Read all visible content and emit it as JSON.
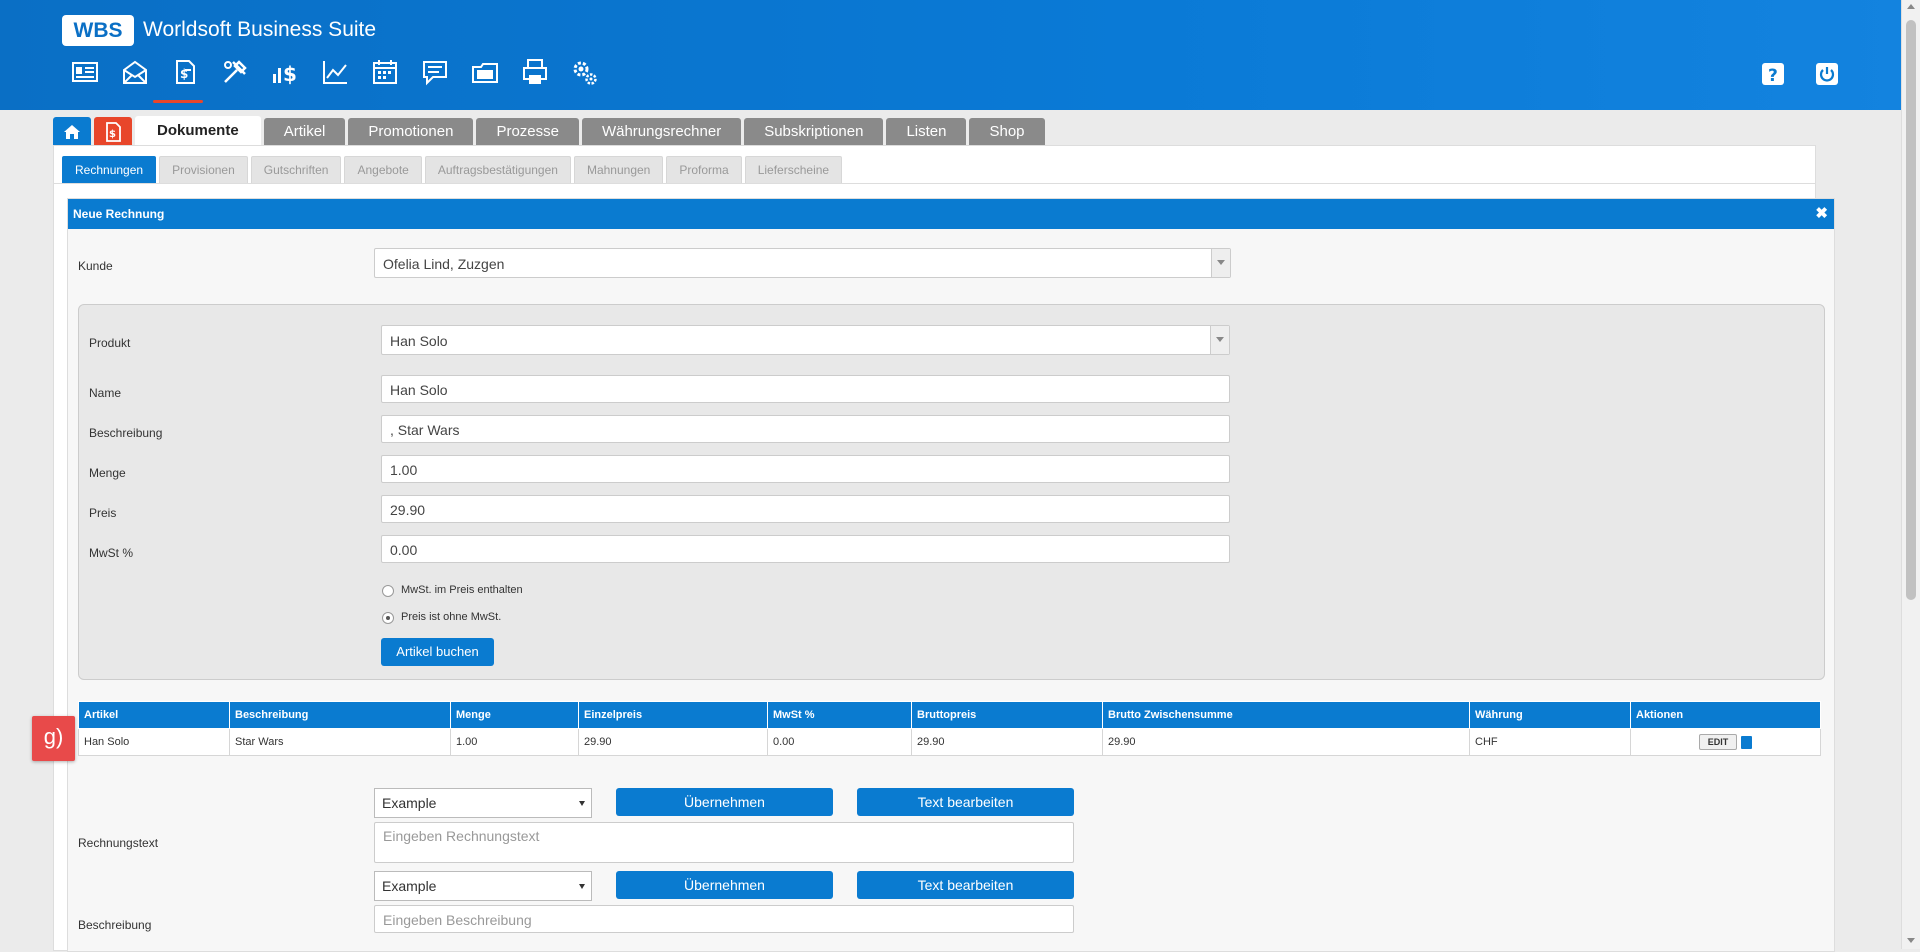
{
  "header": {
    "logo": "WBS",
    "app_title": "Worldsoft Business Suite",
    "nav_icons": [
      "contacts-icon",
      "mail-icon",
      "documents-icon",
      "tools-icon",
      "finance-icon",
      "chart-icon",
      "calendar-icon",
      "messages-icon",
      "files-icon",
      "print-icon",
      "settings-icon"
    ],
    "help_icon": "help-icon",
    "power_icon": "power-icon",
    "accent": "#e8462a",
    "brand": "#0a7bd0"
  },
  "main_tabs": {
    "home_icon": "home-icon",
    "docs_icon": "documents-tab-icon",
    "items": [
      "Dokumente",
      "Artikel",
      "Promotionen",
      "Prozesse",
      "Währungsrechner",
      "Subskriptionen",
      "Listen",
      "Shop"
    ]
  },
  "sub_tabs": [
    "Rechnungen",
    "Provisionen",
    "Gutschriften",
    "Angebote",
    "Auftragsbestätigungen",
    "Mahnungen",
    "Proforma",
    "Lieferscheine"
  ],
  "form": {
    "title": "Neue Rechnung",
    "close": "✖",
    "kunde_label": "Kunde",
    "kunde_value": "Ofelia Lind, Zuzgen",
    "produkt_label": "Produkt",
    "produkt_value": "Han Solo",
    "name_label": "Name",
    "name_value": "Han Solo",
    "beschreibung_label": "Beschreibung",
    "beschreibung_value": ", Star Wars",
    "menge_label": "Menge",
    "menge_value": "1.00",
    "preis_label": "Preis",
    "preis_value": "29.90",
    "mwst_label": "MwSt %",
    "mwst_value": "0.00",
    "radio1": "MwSt. im Preis enthalten",
    "radio2": "Preis ist ohne MwSt.",
    "book_button": "Artikel buchen"
  },
  "table": {
    "headers": [
      "Artikel",
      "Beschreibung",
      "Menge",
      "Einzelpreis",
      "MwSt %",
      "Bruttopreis",
      "Brutto Zwischensumme",
      "Währung",
      "Aktionen"
    ],
    "rows": [
      [
        "Han Solo",
        "Star Wars",
        "1.00",
        "29.90",
        "0.00",
        "29.90",
        "29.90",
        "CHF"
      ]
    ],
    "edit_label": "EDIT"
  },
  "marker": "g)",
  "rechnungstext": {
    "dropdown": "Example",
    "apply": "Übernehmen",
    "edit": "Text bearbeiten",
    "label": "Rechnungstext",
    "placeholder": "Eingeben Rechnungstext"
  },
  "beschreibung2": {
    "dropdown": "Example",
    "apply": "Übernehmen",
    "edit": "Text bearbeiten",
    "label": "Beschreibung",
    "placeholder": "Eingeben Beschreibung"
  }
}
